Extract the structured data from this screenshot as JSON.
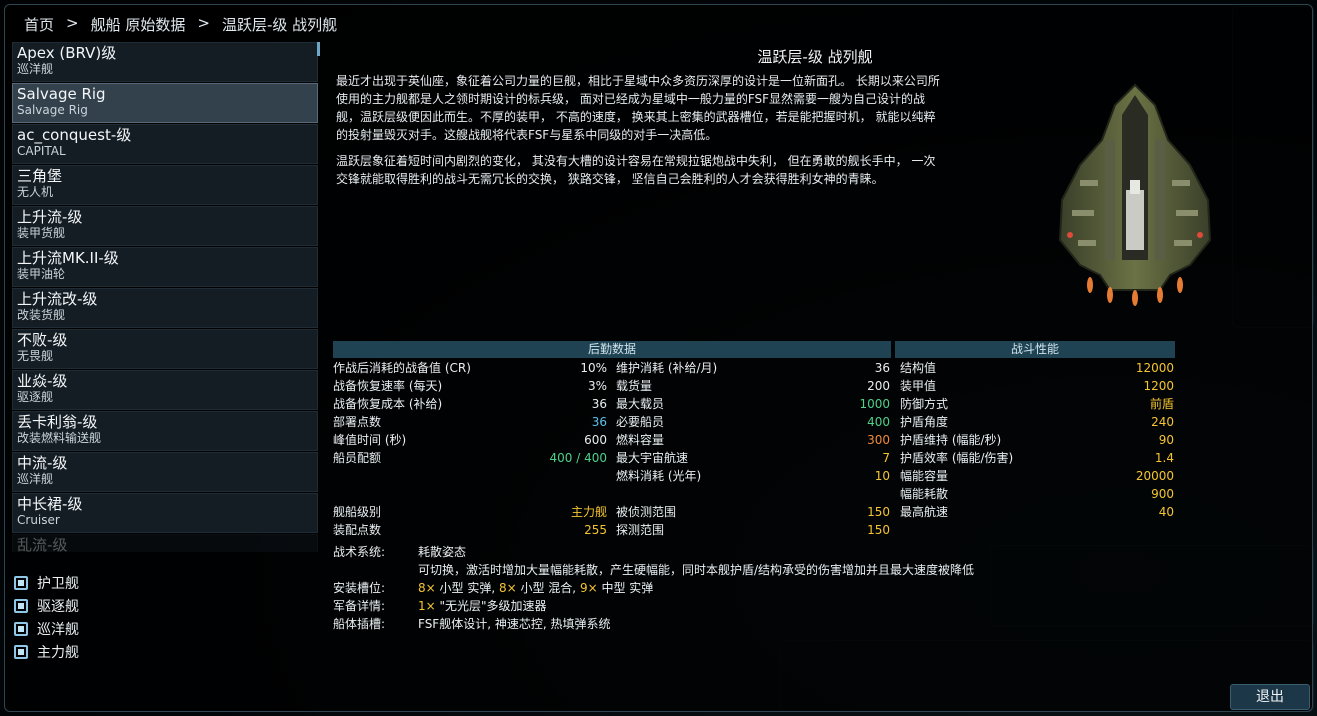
{
  "breadcrumb": {
    "home": "首页",
    "sep": ">",
    "section": "舰船 原始数据",
    "current": "温跃层-级 战列舰"
  },
  "list": [
    {
      "name": "Apex (BRV)级",
      "sub": "巡洋舰"
    },
    {
      "name": "Salvage Rig",
      "sub": "Salvage Rig"
    },
    {
      "name": "ac_conquest-级",
      "sub": "CAPITAL"
    },
    {
      "name": "三角堡",
      "sub": "无人机"
    },
    {
      "name": "上升流-级",
      "sub": "装甲货舰"
    },
    {
      "name": "上升流MK.II-级",
      "sub": "装甲油轮"
    },
    {
      "name": "上升流改-级",
      "sub": "改装货舰"
    },
    {
      "name": "不败-级",
      "sub": "无畏舰"
    },
    {
      "name": "业焱-级",
      "sub": "驱逐舰"
    },
    {
      "name": "丢卡利翁-级",
      "sub": "改装燃料输送舰"
    },
    {
      "name": "中流-级",
      "sub": "巡洋舰"
    },
    {
      "name": "中长裙-级",
      "sub": "Cruiser"
    },
    {
      "name": "乱流-级",
      "sub": ""
    }
  ],
  "filters": [
    "护卫舰",
    "驱逐舰",
    "巡洋舰",
    "主力舰"
  ],
  "ship": {
    "title": "温跃层-级 战列舰",
    "desc1": "最近才出现于英仙座，象征着公司力量的巨舰，相比于星域中众多资历深厚的设计是一位新面孔。 长期以来公司所使用的主力舰都是人之领时期设计的标兵级， 面对已经成为星域中一般力量的FSF显然需要一艘为自己设计的战舰，温跃层级便因此而生。不厚的装甲，  不高的速度， 换来其上密集的武器槽位，若是能把握时机， 就能以纯粹的投射量毁灭对手。这艘战舰将代表FSF与星系中同级的对手一决高低。",
    "desc2": "温跃层象征着短时间内剧烈的变化， 其没有大槽的设计容易在常规拉锯炮战中失利， 但在勇敢的舰长手中， 一次交锋就能取得胜利的战斗无需冗长的交换， 狭路交锋， 坚信自己会胜利的人才会获得胜利女神的青睐。"
  },
  "logistics": {
    "header": "后勤数据",
    "col1": [
      {
        "label": "作战后消耗的战备值 (CR)",
        "value": "10%",
        "color": "w"
      },
      {
        "label": "战备恢复速率 (每天)",
        "value": "3%",
        "color": "w"
      },
      {
        "label": "战备恢复成本 (补给)",
        "value": "36",
        "color": "w"
      },
      {
        "label": " 部署点数",
        "value": "36",
        "color": "c"
      },
      {
        "label": "峰值时间 (秒)",
        "value": "600",
        "color": "w"
      },
      {
        "label": "船员配额",
        "value": "400 / 400",
        "color": "g"
      }
    ],
    "col2": [
      {
        "label": "维护消耗 (补给/月)",
        "value": "36",
        "color": "w"
      },
      {
        "label": "载货量",
        "value": "200",
        "color": "w"
      },
      {
        "label": "最大载员",
        "value": "1000",
        "color": "g"
      },
      {
        "label": "必要船员",
        "value": "400",
        "color": "g"
      },
      {
        "label": "燃料容量",
        "value": "300",
        "color": "o"
      },
      {
        "label": "最大宇宙航速",
        "value": "7",
        "color": "y"
      },
      {
        "label": "燃料消耗 (光年)",
        "value": "10",
        "color": "y"
      }
    ],
    "col1b": [
      {
        "label": "舰船级别",
        "value": "主力舰",
        "color": "y"
      },
      {
        "label": "装配点数",
        "value": "255",
        "color": "y"
      }
    ],
    "col2b": [
      {
        "label": "被侦测范围",
        "value": "150",
        "color": "y"
      },
      {
        "label": "探测范围",
        "value": "150",
        "color": "y"
      }
    ]
  },
  "combat": {
    "header": "战斗性能",
    "rows": [
      {
        "label": "结构值",
        "value": "12000",
        "color": "y"
      },
      {
        "label": "装甲值",
        "value": "1200",
        "color": "y"
      },
      {
        "label": "防御方式",
        "value": "前盾",
        "color": "y"
      },
      {
        "label": "护盾角度",
        "value": "240",
        "color": "y"
      },
      {
        "label": "护盾维持 (幅能/秒)",
        "value": "90",
        "color": "y"
      },
      {
        "label": "护盾效率 (幅能/伤害)",
        "value": "1.4",
        "color": "y"
      },
      {
        "label": "幅能容量",
        "value": "20000",
        "color": "y"
      },
      {
        "label": "幅能耗散",
        "value": "900",
        "color": "y"
      },
      {
        "label": "最高航速",
        "value": "40",
        "color": "y"
      }
    ]
  },
  "modules": {
    "tactical_label": "战术系统:",
    "tactical_name": "耗散姿态",
    "tactical_desc": "可切换，激活时增加大量幅能耗散，产生硬幅能，同时本舰护盾/结构承受的伤害增加并且最大速度被降低",
    "slots_label": "安装槽位:",
    "slots": [
      {
        "n": "8×",
        "t": " 小型 实弹, "
      },
      {
        "n": "8×",
        "t": " 小型 混合, "
      },
      {
        "n": "9×",
        "t": " 中型 实弹"
      }
    ],
    "armament_label": "军备详情:",
    "armament_n": "1×",
    "armament_t": " \"无光层\"多级加速器",
    "hullmods_label": "船体插槽:",
    "hullmods": "FSF舰体设计, 神速芯控, 热填弹系统"
  },
  "exit_label": "退出",
  "colors": {
    "accent": "#f5c531",
    "green": "#4fd18a",
    "cyan": "#5cc2ef",
    "orange": "#f08a3c",
    "header": "#1f4353"
  }
}
